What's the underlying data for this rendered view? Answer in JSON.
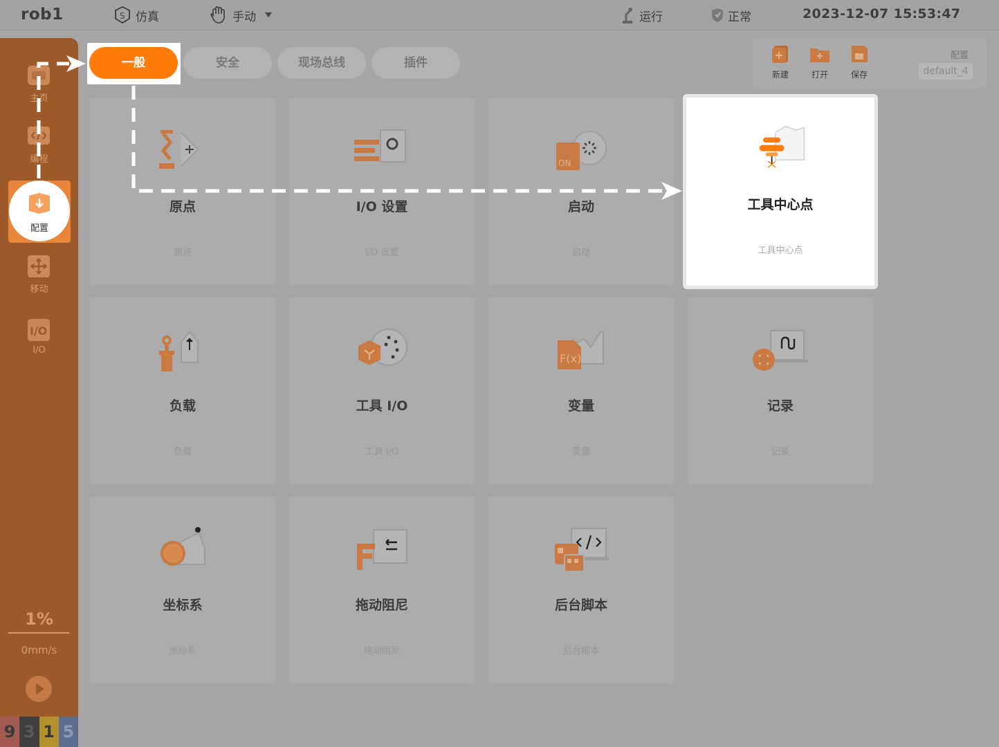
{
  "topbar": {
    "robot_name": "rob1",
    "sim_label": "仿真",
    "manual_label": "手动",
    "run_label": "运行",
    "status_label": "正常",
    "datetime": "2023-12-07 15:53:47"
  },
  "sidebar": {
    "items": [
      {
        "label": "主页",
        "icon": "home-icon"
      },
      {
        "label": "编程",
        "icon": "code-icon"
      },
      {
        "label": "配置",
        "icon": "config-icon",
        "active": true
      },
      {
        "label": "移动",
        "icon": "move-icon"
      },
      {
        "label": "I/O",
        "icon": "io-icon"
      }
    ],
    "speed_percent": "1%",
    "speed_mm": "0mm/s",
    "bottom_digits": [
      "9",
      "3",
      "1",
      "5"
    ]
  },
  "tabs": [
    {
      "label": "一般",
      "active": true
    },
    {
      "label": "安全"
    },
    {
      "label": "现场总线"
    },
    {
      "label": "插件"
    }
  ],
  "file_panel": {
    "new_label": "新建",
    "open_label": "打开",
    "save_label": "保存",
    "config_label": "配置",
    "config_value": "default_4"
  },
  "cards": [
    {
      "title": "原点",
      "subtitle": "原点",
      "icon": "home-position-icon"
    },
    {
      "title": "I/O 设置",
      "subtitle": "I/O 设置",
      "icon": "io-settings-icon"
    },
    {
      "title": "启动",
      "subtitle": "启动",
      "icon": "startup-icon"
    },
    {
      "title": "工具中心点",
      "subtitle": "工具中心点",
      "icon": "tcp-icon"
    },
    {
      "title": "负载",
      "subtitle": "负载",
      "icon": "payload-icon"
    },
    {
      "title": "工具 I/O",
      "subtitle": "工具 I/O",
      "icon": "tool-io-icon"
    },
    {
      "title": "变量",
      "subtitle": "变量",
      "icon": "variable-icon"
    },
    {
      "title": "记录",
      "subtitle": "记录",
      "icon": "record-icon"
    },
    {
      "title": "坐标系",
      "subtitle": "坐标系",
      "icon": "frame-icon"
    },
    {
      "title": "拖动阻尼",
      "subtitle": "拖动阻尼",
      "icon": "drag-damping-icon"
    },
    {
      "title": "后台脚本",
      "subtitle": "后台脚本",
      "icon": "background-script-icon"
    }
  ],
  "colors": {
    "accent": "#ff7c0a",
    "sidebar": "#9d5a2a",
    "dim_background": "#a6a6a6"
  }
}
